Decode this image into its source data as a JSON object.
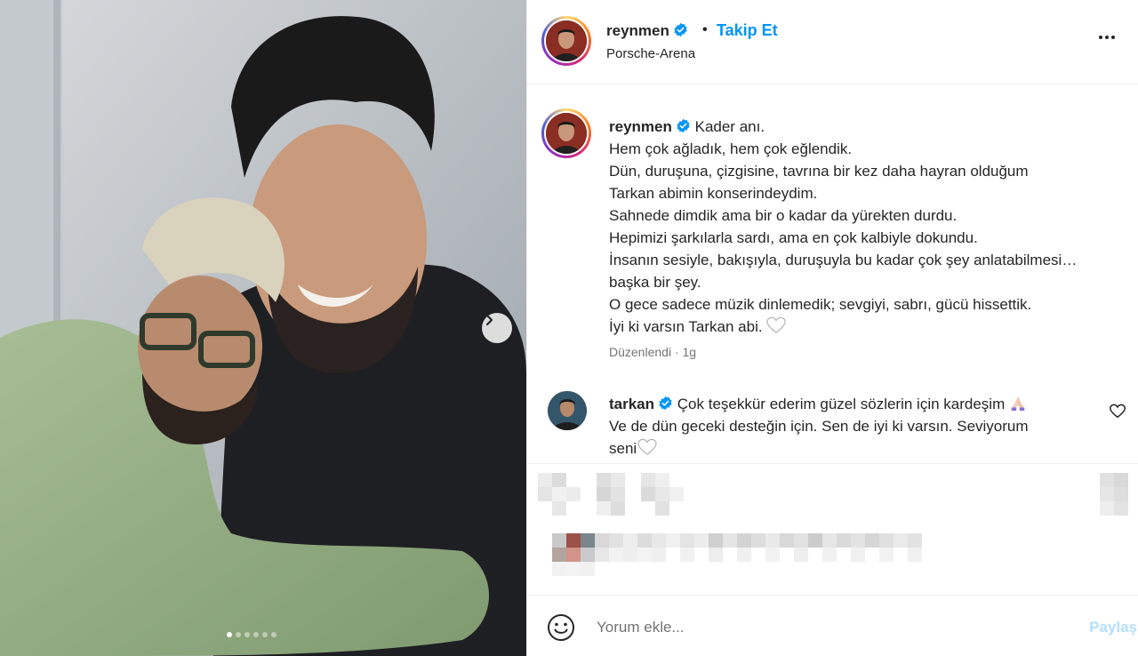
{
  "post": {
    "username": "reynmen",
    "separator": "•",
    "follow_label": "Takip Et",
    "location": "Porsche-Arena",
    "photo_count": 6,
    "photo_index": 1
  },
  "caption": {
    "username": "reynmen",
    "lines": [
      "Kader anı.",
      "Hem çok ağladık, hem çok eğlendik.",
      "Dün, duruşuna, çizgisine, tavrına bir kez daha hayran olduğum",
      "Tarkan abimin konserindeydim.",
      "Sahnede dimdik ama bir o kadar da yürekten durdu.",
      "Hepimizi şarkılarla sardı, ama en çok kalbiyle dokundu.",
      "İnsanın sesiyle, bakışıyla, duruşuyla bu kadar çok şey anlatabilmesi…",
      "başka bir şey.",
      "O gece sadece müzik dinlemedik; sevgiyi, sabrı, gücü hissettik.",
      "İyi ki varsın Tarkan abi."
    ],
    "meta": "Düzenlendi · 1g"
  },
  "comment": {
    "username": "tarkan",
    "line1": "Çok teşekkür ederim güzel sözlerin için kardeşim",
    "line2": "Ve de dün geceki desteğin için. Sen de iyi ki varsın. Seviyorum",
    "line3": "seni"
  },
  "comment_bar": {
    "placeholder": "Yorum ekle...",
    "share_label": "Paylaş"
  },
  "colors": {
    "link": "#0095f6",
    "share_disabled": "#b2dffc",
    "verified": "#0095f6",
    "muted_text": "#737373"
  },
  "icons": [
    "chevron-right-icon",
    "more-icon",
    "verified-icon",
    "heart-icon",
    "emoji-icon"
  ]
}
